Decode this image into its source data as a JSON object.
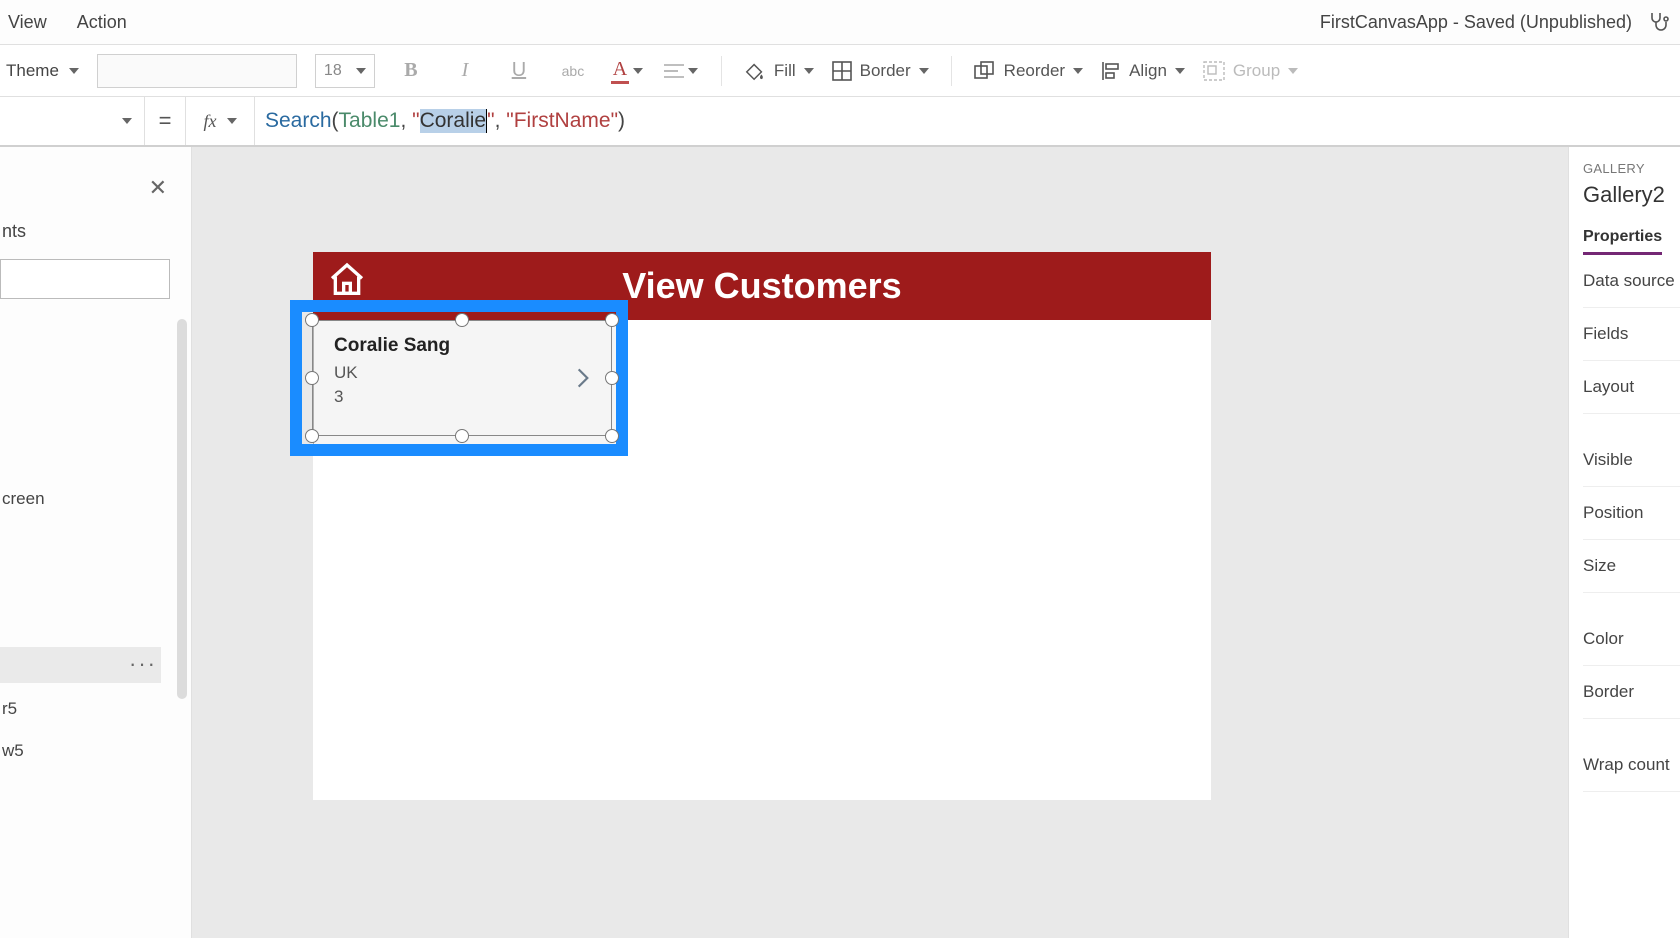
{
  "menu": {
    "view": "View",
    "action": "Action"
  },
  "app_title": "FirstCanvasApp - Saved (Unpublished)",
  "ribbon": {
    "theme_label": "Theme",
    "font_size": "18",
    "fill_label": "Fill",
    "border_label": "Border",
    "reorder_label": "Reorder",
    "align_label": "Align",
    "group_label": "Group"
  },
  "formula": {
    "fn": "Search",
    "table": "Table1",
    "str_open_chars": "Cor",
    "str_sel_tail": "lie",
    "full_search_str": "Coralie",
    "col": "FirstName"
  },
  "left_panel": {
    "header": "nts",
    "tree_item_screen": "creen",
    "tree_item_r5": "r5",
    "tree_item_w5": "w5"
  },
  "screen": {
    "title": "View Customers",
    "gallery_item": {
      "name": "Coralie  Sang",
      "country": "UK",
      "count": "3"
    }
  },
  "right_panel": {
    "category": "GALLERY",
    "selected_name": "Gallery2",
    "tab_properties": "Properties",
    "rows": {
      "data_source": "Data source",
      "fields": "Fields",
      "layout": "Layout",
      "visible": "Visible",
      "position": "Position",
      "size": "Size",
      "color": "Color",
      "border": "Border",
      "wrap_count": "Wrap count"
    }
  }
}
